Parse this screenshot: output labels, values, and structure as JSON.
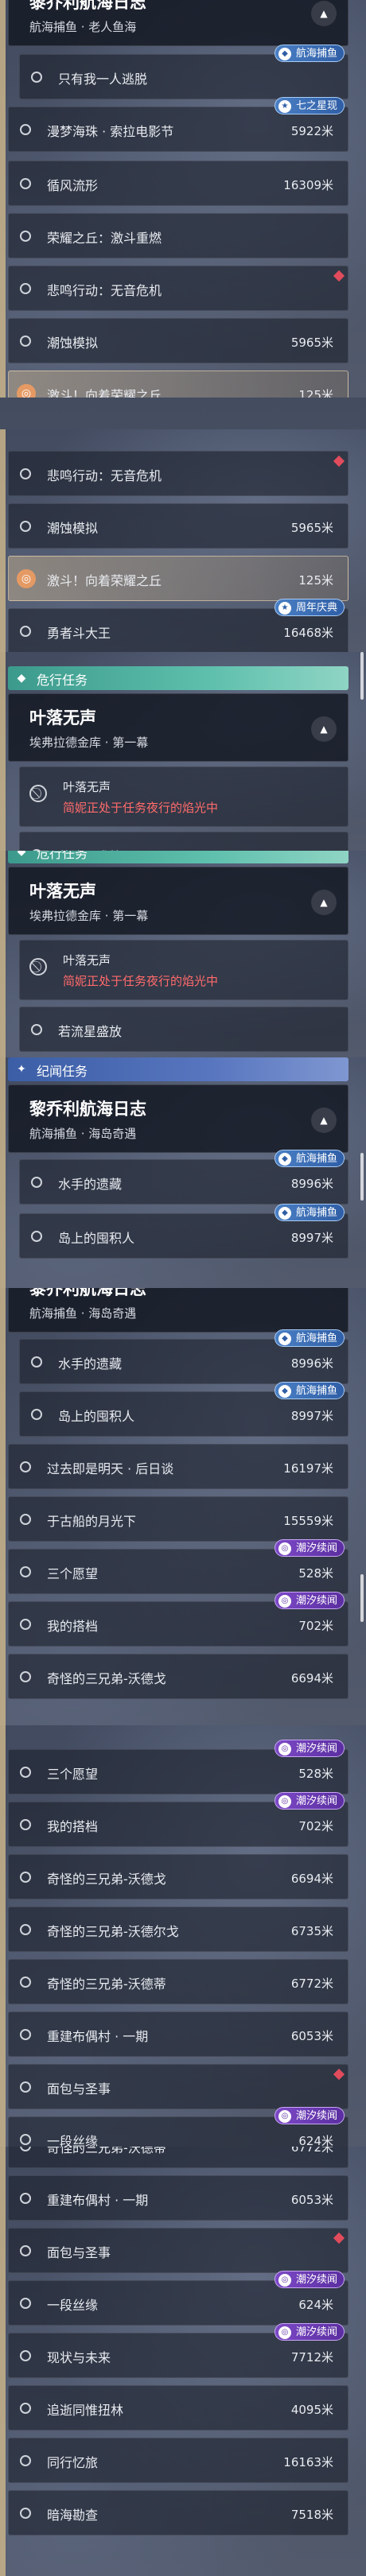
{
  "colors": {
    "accent_gold": "#c9b48a",
    "warn_red": "#ff6b6b",
    "danger_marker": "#e04c5c",
    "badge_blue": "#3f72b8",
    "badge_purple": "#6a3bb3",
    "cat_green": "#4fae9d",
    "cat_blue": "#4b6bb2"
  },
  "header_journal": {
    "title": "黎乔利航海日志",
    "subtitle_fish": "航海捕鱼 · 老人鱼海",
    "subtitle_meet": "航海捕鱼 · 海岛奇遇"
  },
  "header_leaf": {
    "title": "叶落无声",
    "subtitle": "埃弗拉德金库 · 第一幕"
  },
  "status_leaf": {
    "name": "叶落无声",
    "warning": "简妮正处于任务夜行的焰光中"
  },
  "cats": {
    "danger": "危行任务",
    "journal": "纪闻任务"
  },
  "badges": {
    "fishing": "航海捕鱼",
    "sky": "七之星现",
    "anniv": "周年庆典",
    "tide": "潮汐续闻"
  },
  "tasks": {
    "alone": "只有我一人逃脱",
    "dream": "漫梦海珠 · 索拉电影节",
    "cycle": "循风流形",
    "glory": "荣耀之丘：激斗重燃",
    "sorrow": "悲鸣行动：无音危机",
    "tide_sim": "潮蚀模拟",
    "fight": "激斗！向着荣耀之丘",
    "brave": "勇者斗大王",
    "meteor": "若流星盛放",
    "sailor": "水手的遗藏",
    "island": "岛上的囤积人",
    "past": "过去即是明天 · 后日谈",
    "moon": "于古船的月光下",
    "wish": "三个愿望",
    "mine": "我的搭档",
    "bro_d": "奇怪的三兄弟-沃德戈",
    "bro_e": "奇怪的三兄弟-沃德尔戈",
    "bro_f": "奇怪的三兄弟-沃德蒂",
    "puppet": "重建布偶村 · 一期",
    "bread": "面包与圣事",
    "silk": "一段丝缘",
    "now": "现状与未来",
    "trace": "追逝同惟扭林",
    "travel": "同行忆旅",
    "dark": "暗海勘查"
  },
  "dist": {
    "dream": "5922米",
    "cycle": "16309米",
    "tide_sim": "5965米",
    "fight": "125米",
    "brave": "16468米",
    "sailor": "8996米",
    "island": "8997米",
    "past": "16197米",
    "moon": "15559米",
    "wish": "528米",
    "mine": "702米",
    "bro_d": "6694米",
    "bro_e": "6735米",
    "bro_f": "6772米",
    "puppet": "6053米",
    "silk": "624米",
    "now": "7712米",
    "trace": "4095米",
    "travel": "16163米",
    "dark": "7518米"
  },
  "icons": {
    "circle": "circle-icon",
    "ban": "ban-icon",
    "target": "target-icon",
    "chevron": "chevron-up-icon",
    "diamond": "danger-diamond-icon",
    "fish": "fish-icon",
    "star": "star-icon"
  }
}
